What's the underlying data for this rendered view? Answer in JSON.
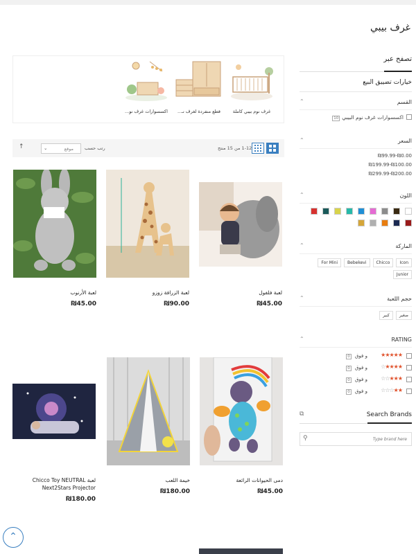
{
  "page_title": "غرف بيبي",
  "sidebar": {
    "browse_label": "تصفح عبر",
    "narrow_label": "خيارات تضييق البيع",
    "category": {
      "title": "القسم",
      "items": [
        {
          "label": "اكسسوارات غرف نوم البيبي",
          "count": "10"
        }
      ]
    },
    "price": {
      "title": "السعر",
      "items": [
        {
          "label": "₪0.00-₪99.99",
          "count": ""
        },
        {
          "label": "₪100.00-₪199.99",
          "count": ""
        },
        {
          "label": "₪200.00-₪299.99",
          "count": ""
        }
      ]
    },
    "color": {
      "title": "اللون",
      "colors": [
        "#ffffff",
        "#3a2a12",
        "#8c8c8c",
        "#e56bd3",
        "#1f8fd6",
        "#27b9a9",
        "#d8d34a",
        "#1a5a5a",
        "#d7312f",
        "#9a1b1b",
        "#1b2a52",
        "#e87d10",
        "#b0b0b0",
        "#d5a63a"
      ]
    },
    "brand": {
      "title": "الماركة",
      "items": [
        "Icon",
        "Chicco",
        "Bebekevi",
        "For Mini",
        "Junior"
      ]
    },
    "toy_size": {
      "title": "حجم اللعبة",
      "items": [
        "صغير",
        "كبير"
      ]
    },
    "rating": {
      "title": "RATING",
      "rows": [
        {
          "stars": 5,
          "label": "و فوق",
          "count": "0"
        },
        {
          "stars": 4,
          "label": "و فوق",
          "count": "0"
        },
        {
          "stars": 3,
          "label": "و فوق",
          "count": "0"
        },
        {
          "stars": 2,
          "label": "و فوق",
          "count": "0"
        }
      ]
    },
    "search_brands": {
      "title": "Search Brands",
      "placeholder": "Type brand here"
    }
  },
  "subcategories": [
    {
      "label": "غرف نوم بيبي كاملة"
    },
    {
      "label": "قطع منفردة لغرف نـ..."
    },
    {
      "label": "اكسسوارات غرف نو..."
    }
  ],
  "toolbar": {
    "count_text": "1-12 من 15 منتج",
    "sort_label": "رتب حسب",
    "sort_value": "موقع"
  },
  "products": [
    {
      "name": "لعبة فلفول",
      "price": "₪45.00"
    },
    {
      "name": "لعبة الزرافة زوزو",
      "price": "₪90.00"
    },
    {
      "name": "لعبة الأرنوب",
      "price": "₪45.00"
    },
    {
      "name": "دمى الحيوانات الرائعة",
      "price": "₪45.00"
    },
    {
      "name": "خيمة اللعب",
      "price": "₪180.00"
    },
    {
      "name": "لعبة Chicco Toy NEUTRAL Next2Stars Projector",
      "price": "₪180.00"
    }
  ],
  "scroll_top_icon": "arrow-up-icon"
}
